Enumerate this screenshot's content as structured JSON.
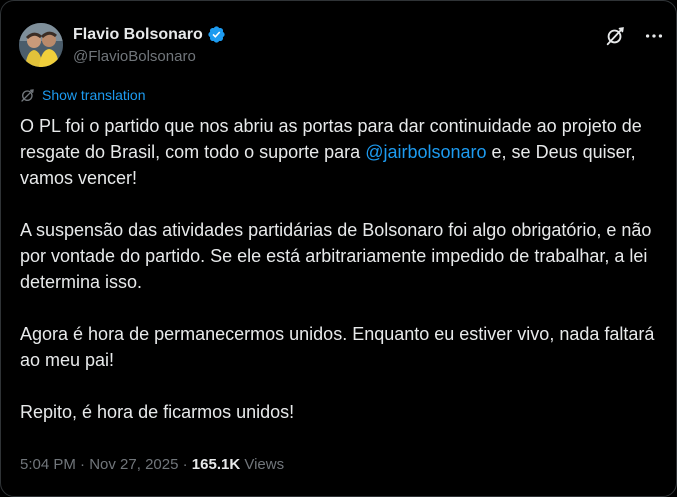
{
  "author": {
    "display_name": "Flavio Bolsonaro",
    "handle": "@FlavioBolsonaro",
    "avatar_icon": "profile-photo",
    "verified_icon": "verified-badge-icon",
    "verified_color": "#1d9bf0"
  },
  "actions": {
    "grok_icon": "grok-icon",
    "more_icon": "more-options-icon"
  },
  "translation": {
    "icon": "translate-icon",
    "label": "Show translation"
  },
  "body": {
    "p1_before": "O PL foi o partido que nos abriu as portas para dar continuidade ao projeto de resgate do Brasil, com todo o suporte para ",
    "p1_mention": "@jairbolsonaro",
    "p1_after": " e, se Deus quiser, vamos vencer!",
    "p2": "A suspensão das atividades partidárias de Bolsonaro foi algo obrigatório, e não por vontade do partido. Se ele está arbitrariamente impedido de trabalhar, a lei determina isso.",
    "p3": "Agora é hora de permanecermos unidos. Enquanto eu estiver vivo, nada faltará ao meu pai!",
    "p4": "Repito, é hora de ficarmos unidos!"
  },
  "meta": {
    "time": "5:04 PM",
    "separator": " · ",
    "date": "Nov 27, 2025",
    "views_count": "165.1K",
    "views_label": " Views"
  },
  "colors": {
    "background": "#000000",
    "text": "#e7e9ea",
    "secondary": "#71767b",
    "link": "#1d9bf0",
    "border": "#2f3336"
  }
}
